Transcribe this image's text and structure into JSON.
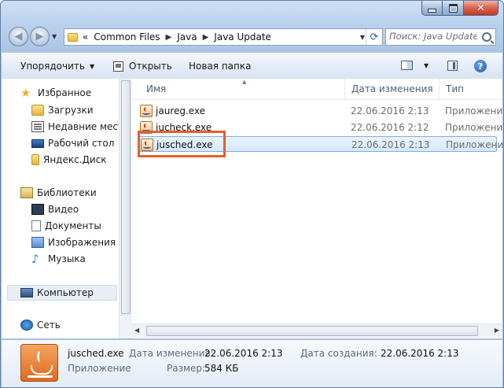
{
  "nav": {
    "breadcrumb_prefix": "«",
    "path": [
      "Common Files",
      "Java",
      "Java Update"
    ],
    "search_placeholder": "Поиск: Java Update"
  },
  "toolbar": {
    "organize_label": "Упорядочить",
    "open_label": "Открыть",
    "new_folder_label": "Новая папка"
  },
  "sidebar": {
    "favorites_label": "Избранное",
    "favorites": [
      "Загрузки",
      "Недавние места",
      "Рабочий стол",
      "Яндекс.Диск"
    ],
    "libraries_label": "Библиотеки",
    "libraries": [
      "Видео",
      "Документы",
      "Изображения",
      "Музыка"
    ],
    "computer_label": "Компьютер",
    "network_label": "Сеть"
  },
  "columns": {
    "name": "Имя",
    "date": "Дата изменения",
    "type": "Тип"
  },
  "files": [
    {
      "name": "jaureg.exe",
      "date": "22.06.2016 2:13",
      "type": "Приложение"
    },
    {
      "name": "jucheck.exe",
      "date": "22.06.2016 2:12",
      "type": "Приложение"
    },
    {
      "name": "jusched.exe",
      "date": "22.06.2016 2:13",
      "type": "Приложение"
    }
  ],
  "details": {
    "filename": "jusched.exe",
    "type": "Приложение",
    "modified_label": "Дата изменения:",
    "modified_value": "22.06.2016 2:13",
    "size_label": "Размер:",
    "size_value": "584 КБ",
    "created_label": "Дата создания:",
    "created_value": "22.06.2016 2:13"
  },
  "colors": {
    "highlight": "#e3612b",
    "selection": "#d6e9fb"
  }
}
